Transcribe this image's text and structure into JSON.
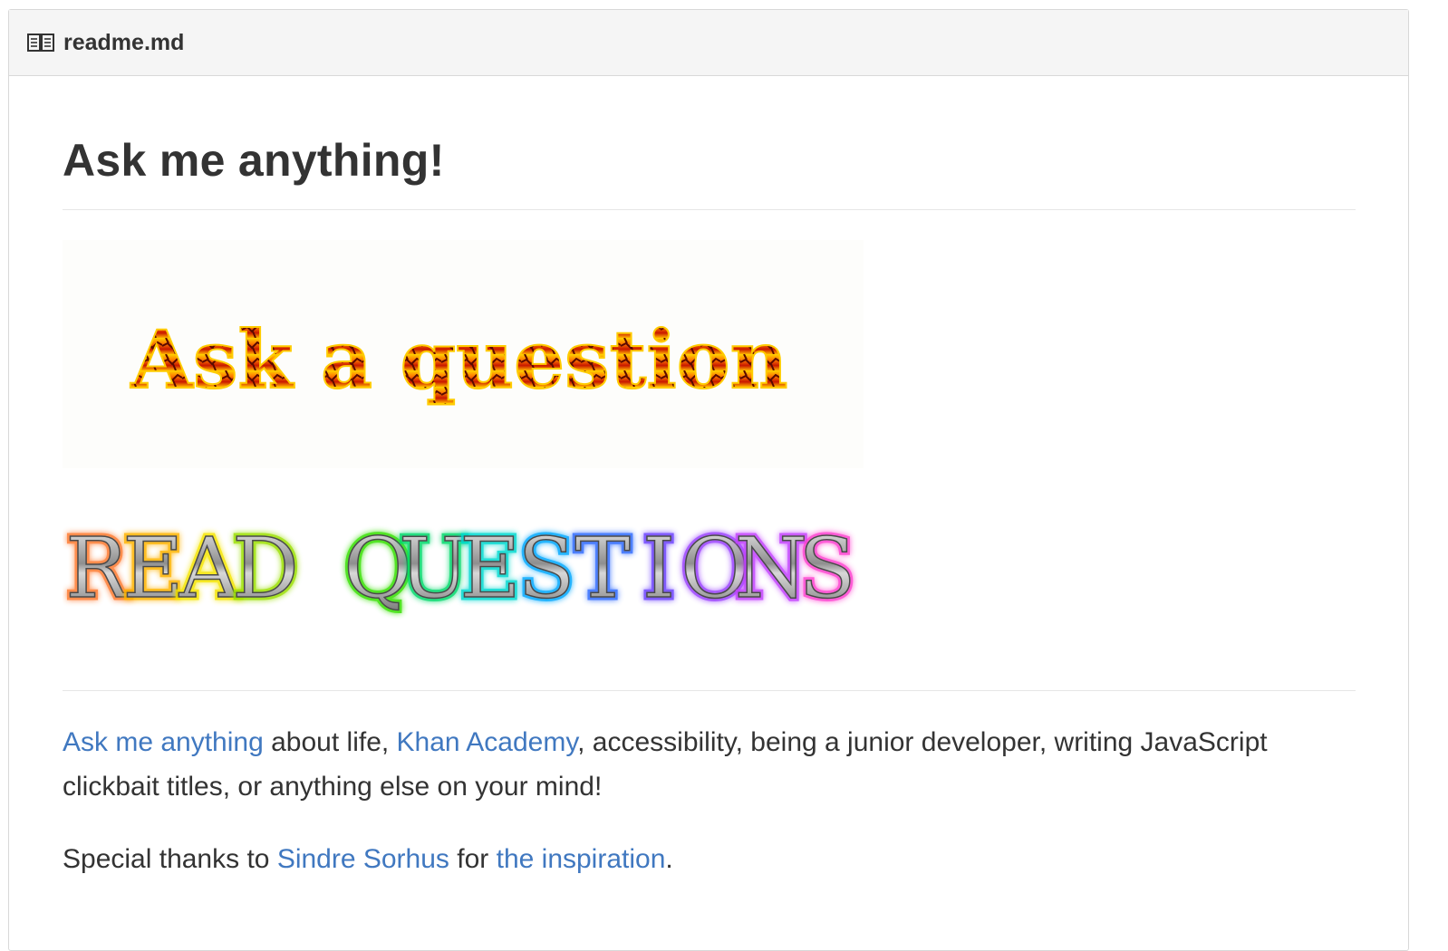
{
  "header": {
    "title": "readme.md",
    "icon": "book-icon"
  },
  "main": {
    "title": "Ask me anything!",
    "ask_banner": {
      "text": "Ask a question",
      "style": "fire-lava lettering"
    },
    "read_banner": {
      "letters": [
        "R",
        "E",
        "A",
        "D",
        " ",
        "Q",
        "U",
        "E",
        "S",
        "T",
        "I",
        "O",
        "N",
        "S"
      ],
      "text": "READ QUESTIONS",
      "glow_colors": [
        "#ff7a2f",
        "#ffb300",
        "#f5e500",
        "#9be000",
        "#34e000",
        "#00d96a",
        "#00d9d0",
        "#00a8ff",
        "#2f6bff",
        "#6a3fff",
        "#9a3fff",
        "#c23fff",
        "#ff3fd0",
        "#ff3f8a"
      ]
    },
    "paragraph1": {
      "link1": "Ask me anything",
      "text1": " about life, ",
      "link2": "Khan Academy",
      "text2": ", accessibility, being a junior developer, writing JavaScript clickbait titles, or anything else on your mind!"
    },
    "paragraph2": {
      "text1": "Special thanks to ",
      "link1": "Sindre Sorhus",
      "text2": " for ",
      "link2": "the inspiration",
      "text3": "."
    }
  },
  "colors": {
    "link": "#4078c0",
    "text": "#333333",
    "header_bg": "#f5f5f5",
    "border": "#d8d8d8"
  }
}
